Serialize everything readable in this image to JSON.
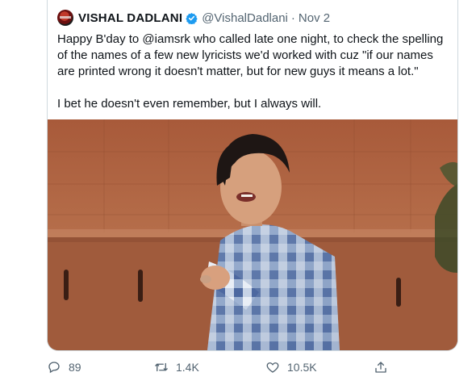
{
  "tweet": {
    "author_name": "VISHAL DADLANI",
    "handle": "@VishalDadlani",
    "separator": "·",
    "date": "Nov 2",
    "lines": [
      "Happy B'day to @iamsrk who called late one night, to check the spelling",
      "of the names of a few new lyricists we'd worked with cuz \"if our names",
      "are printed wrong it doesn't matter, but for new guys it means a lot.\"",
      "I bet he doesn't even remember, but I always will."
    ]
  },
  "actions": {
    "reply_count": "89",
    "retweet_count": "1.4K",
    "like_count": "10.5K"
  },
  "icons": [
    "verified-icon",
    "reply-icon",
    "retweet-icon",
    "like-icon",
    "share-icon"
  ],
  "colors": {
    "verified": "#1d9bf0",
    "muted": "#536471",
    "border": "#cfd9de",
    "text": "#0f1419"
  }
}
